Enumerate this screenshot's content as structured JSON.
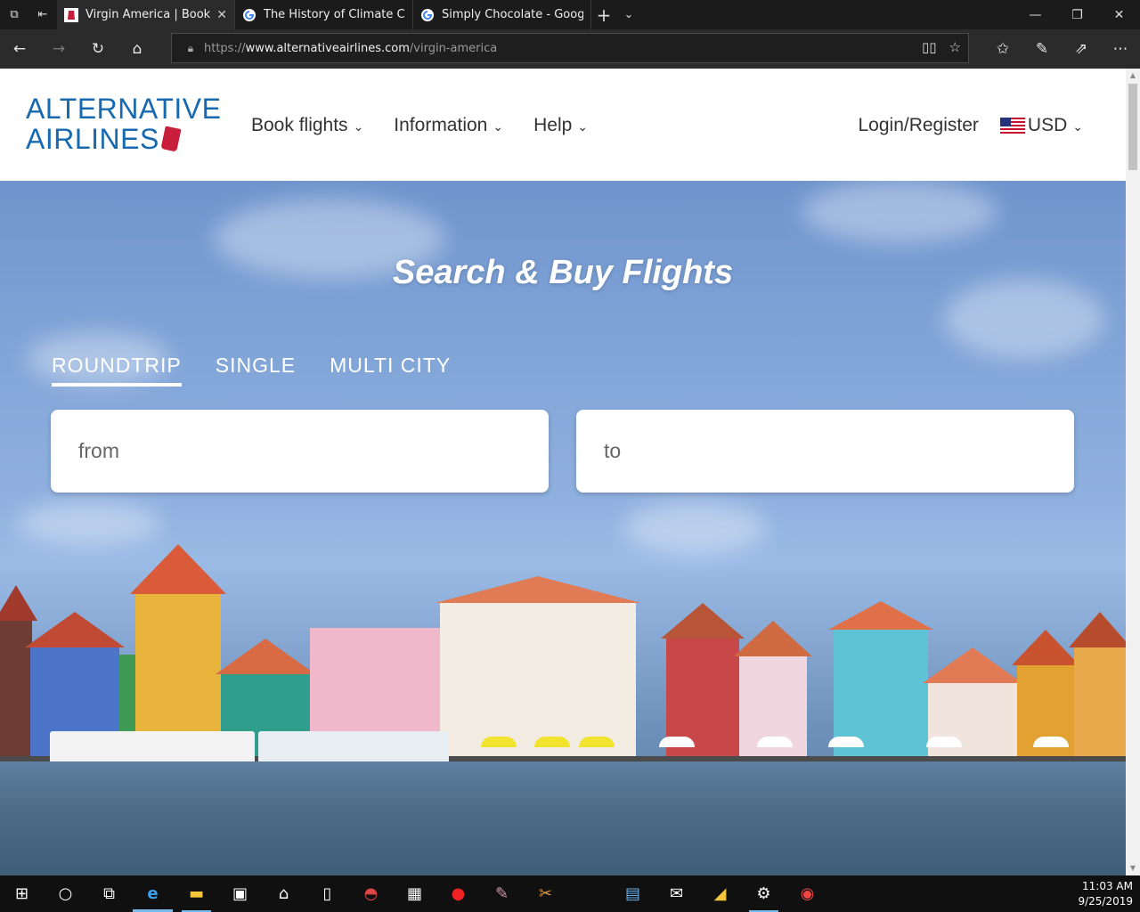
{
  "browser": {
    "tabs": [
      {
        "title": "Virgin America | Book Fl",
        "active": true,
        "favicon": "virgin-logo-icon"
      },
      {
        "title": "The History of Climate Char",
        "active": false,
        "favicon": "google-icon"
      },
      {
        "title": "Simply Chocolate - Google",
        "active": false,
        "favicon": "google-icon"
      }
    ],
    "url_prefix": "https://",
    "url_domain": "www.alternativeairlines.com",
    "url_path": "/virgin-america"
  },
  "site": {
    "logo_line1": "ALTERNATIVE",
    "logo_line2": "AIRLINES",
    "nav": {
      "book": "Book flights",
      "info": "Information",
      "help": "Help"
    },
    "login": "Login/Register",
    "currency": "USD"
  },
  "hero": {
    "title": "Search & Buy Flights",
    "trip_types": [
      "ROUNDTRIP",
      "SINGLE",
      "MULTI CITY"
    ],
    "from_placeholder": "from",
    "to_placeholder": "to"
  },
  "taskbar": {
    "time": "11:03 AM",
    "date": "9/25/2019"
  },
  "colors": {
    "brand": "#1769b0",
    "tag": "#c81e3c"
  }
}
